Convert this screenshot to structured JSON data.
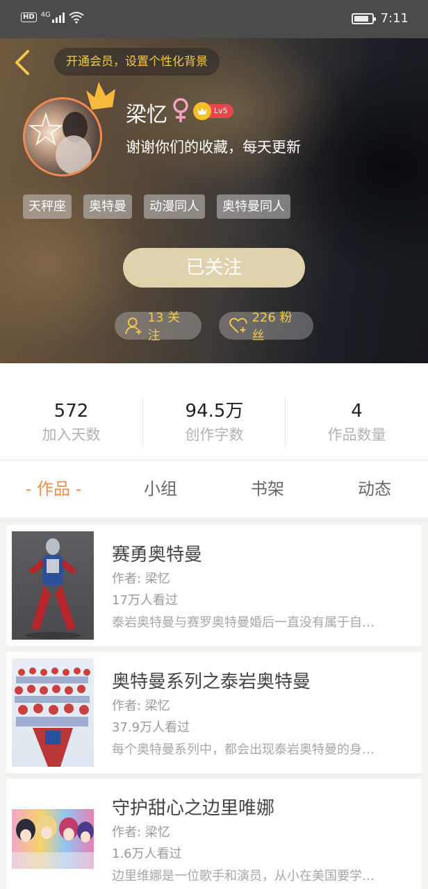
{
  "status_bar": {
    "hd": "HD",
    "network": "4G",
    "time": "7:11"
  },
  "header": {
    "vip_prompt": "开通会员，设置个性化背景",
    "username": "梁忆",
    "gender_symbol": "♀",
    "level": "Lv5",
    "signature": "谢谢你们的收藏，每天更新",
    "tags": [
      "天秤座",
      "奥特曼",
      "动漫同人",
      "奥特曼同人"
    ],
    "follow_button": "已关注",
    "following": "13 关注",
    "fans": "226 粉丝"
  },
  "stats": [
    {
      "value": "572",
      "label": "加入天数"
    },
    {
      "value": "94.5万",
      "label": "创作字数"
    },
    {
      "value": "4",
      "label": "作品数量"
    }
  ],
  "tabs": [
    "- 作品 -",
    "小组",
    "书架",
    "动态"
  ],
  "works": [
    {
      "title": "赛勇奥特曼",
      "author": "作者: 梁忆",
      "views": "17万人看过",
      "desc": "泰岩奥特曼与赛罗奥特曼婚后一直没有属于自…"
    },
    {
      "title": "奥特曼系列之泰岩奥特曼",
      "author": "作者: 梁忆",
      "views": "37.9万人看过",
      "desc": "每个奥特曼系列中，都会出现泰岩奥特曼的身…"
    },
    {
      "title": "守护甜心之边里唯娜",
      "author": "作者: 梁忆",
      "views": "1.6万人看过",
      "desc": "边里维娜是一位歌手和演员，从小在美国要学…"
    }
  ],
  "colors": {
    "accent": "#ee8e4d",
    "gold": "#f2c94c",
    "follow_button": "#dfd2ac",
    "level_badge": "#e8474b"
  }
}
